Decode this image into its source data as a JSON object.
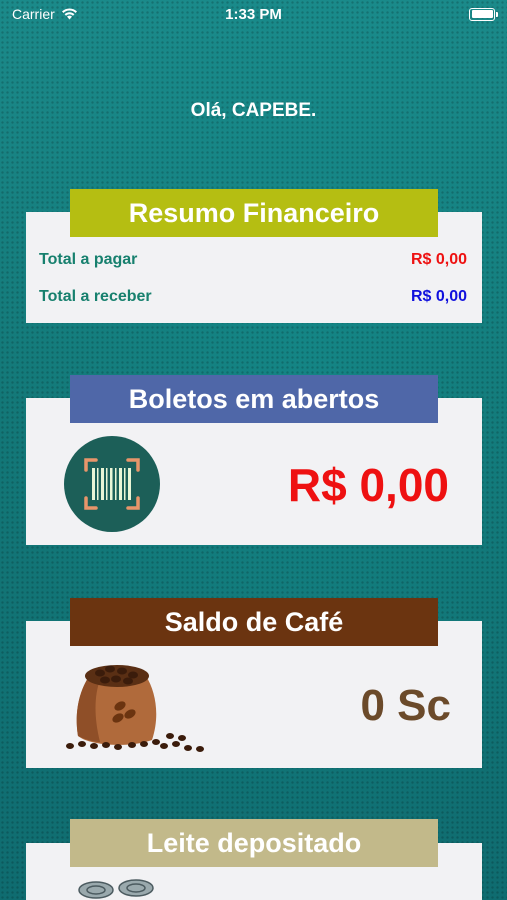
{
  "status_bar": {
    "carrier": "Carrier",
    "time": "1:33 PM"
  },
  "greeting": "Olá, CAPEBE.",
  "financial_summary": {
    "title": "Resumo Financeiro",
    "header_color": "#b5be12",
    "rows": [
      {
        "label": "Total a pagar",
        "value": "R$ 0,00",
        "value_color": "#ee1111"
      },
      {
        "label": "Total a receber",
        "value": "R$ 0,00",
        "value_color": "#1111dd"
      }
    ]
  },
  "boletos": {
    "title": "Boletos em abertos",
    "header_color": "#4f67a8",
    "value": "R$ 0,00",
    "value_color": "#ee1111",
    "icon": "barcode-scan-icon"
  },
  "coffee": {
    "title": "Saldo de Café",
    "header_color": "#6b3410",
    "value": "0 Sc",
    "value_color": "#6b4a2a",
    "icon": "coffee-sack-icon"
  },
  "milk": {
    "title": "Leite depositado",
    "header_color": "#c2b98a",
    "icon": "milk-cans-icon"
  }
}
